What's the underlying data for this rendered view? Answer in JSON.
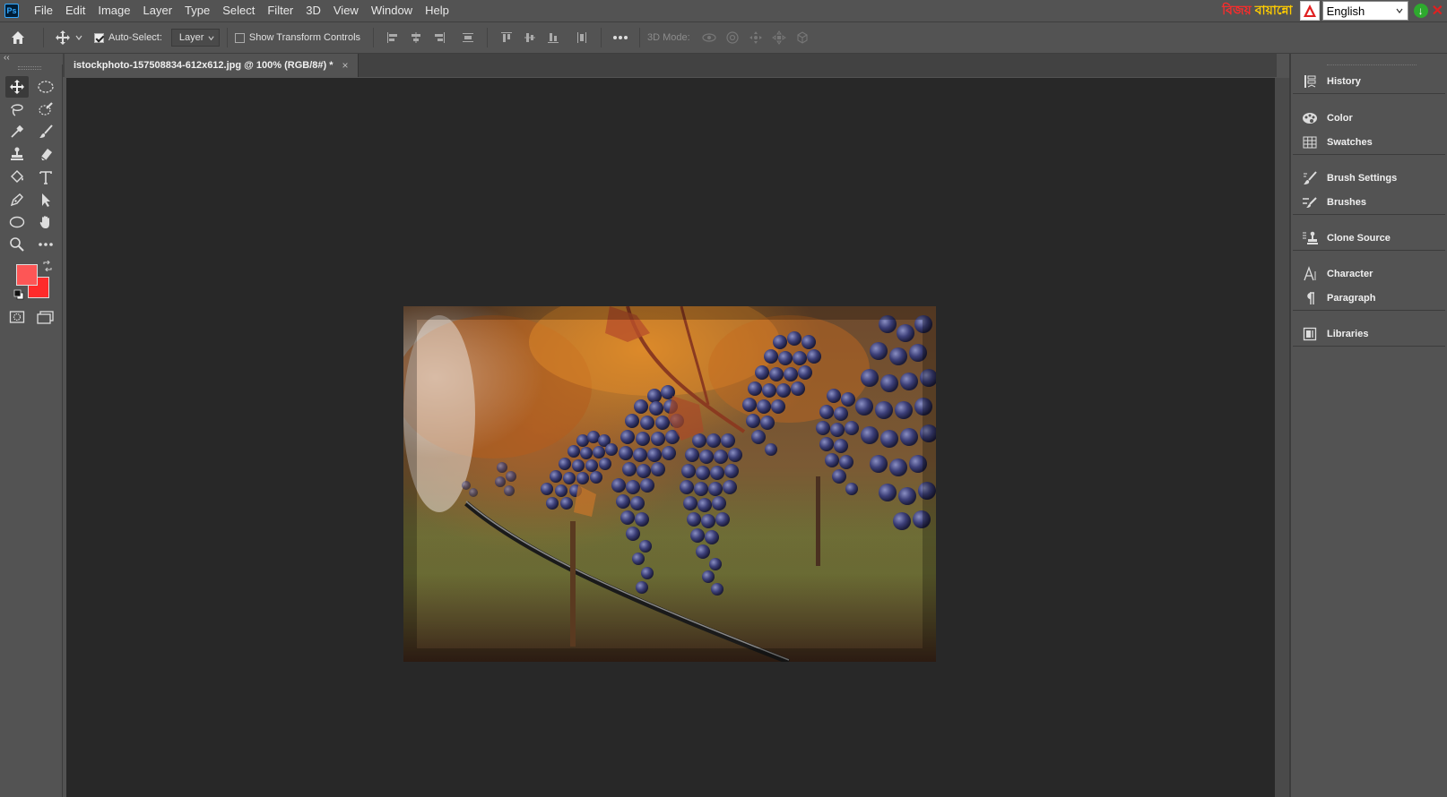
{
  "menubar": {
    "app_icon": "Ps",
    "items": [
      "File",
      "Edit",
      "Image",
      "Layer",
      "Type",
      "Select",
      "Filter",
      "3D",
      "View",
      "Window",
      "Help"
    ],
    "ime_label_1": "বিজয়",
    "ime_label_2": "বায়ান্নো",
    "language": "English"
  },
  "options": {
    "auto_select_label": "Auto-Select:",
    "auto_select_checked": true,
    "layer_dropdown": "Layer",
    "show_transform_label": "Show Transform Controls",
    "show_transform_checked": false,
    "mode_label": "3D Mode:"
  },
  "document": {
    "tab_title": "istockphoto-157508834-612x612.jpg @ 100% (RGB/8#) *",
    "close_glyph": "×"
  },
  "colors": {
    "foreground": "#fd5656",
    "background": "#fe2b2b",
    "canvas_bg": "#282828",
    "ui_bg": "#535353"
  },
  "panels": {
    "groups": [
      [
        {
          "label": "History",
          "icon": "history-icon"
        }
      ],
      [
        {
          "label": "Color",
          "icon": "color-palette-icon"
        },
        {
          "label": "Swatches",
          "icon": "swatches-grid-icon"
        }
      ],
      [
        {
          "label": "Brush Settings",
          "icon": "brush-settings-icon"
        },
        {
          "label": "Brushes",
          "icon": "brushes-icon"
        }
      ],
      [
        {
          "label": "Clone Source",
          "icon": "clone-source-icon"
        }
      ],
      [
        {
          "label": "Character",
          "icon": "character-icon"
        },
        {
          "label": "Paragraph",
          "icon": "paragraph-icon"
        }
      ],
      [
        {
          "label": "Libraries",
          "icon": "libraries-icon"
        }
      ]
    ]
  }
}
